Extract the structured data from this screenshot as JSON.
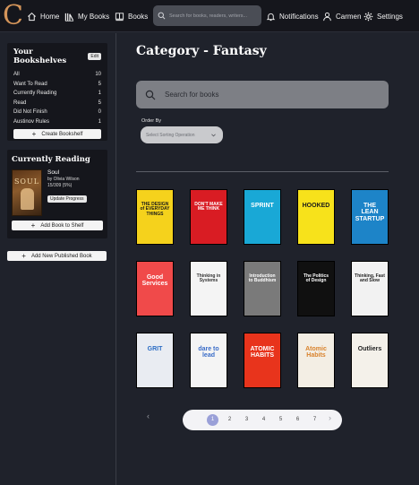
{
  "brand": {
    "logo_letter": "C"
  },
  "nav": {
    "home": "Home",
    "my_books": "My Books",
    "books": "Books",
    "search_placeholder": "Search for books, readers, writers...",
    "notifications": "Notifications",
    "user": "Carmen",
    "settings": "Settings"
  },
  "sidebar": {
    "shelves_title": "Your Bookshelves",
    "edit_label": "Edit",
    "shelves": [
      {
        "name": "All",
        "count": "10"
      },
      {
        "name": "Want To Read",
        "count": "5"
      },
      {
        "name": "Currently Reading",
        "count": "1"
      },
      {
        "name": "Read",
        "count": "5"
      },
      {
        "name": "Did Not Finish",
        "count": "0"
      },
      {
        "name": "Austinov Rules",
        "count": "1"
      }
    ],
    "create_shelf": "Create Bookshelf",
    "reading_title": "Currently Reading",
    "current_book": {
      "cover_text": "SOUL",
      "title": "Soul",
      "author": "by Olivia Wilson",
      "progress": "15/309 (5%)",
      "update": "Update Progress"
    },
    "add_to_shelf": "Add Book to Shelf",
    "add_published": "Add New Published Book"
  },
  "main": {
    "title": "Category - Fantasy",
    "search_placeholder": "Search for books",
    "order_label": "Order By",
    "sort_placeholder": "Select Sorting Operation",
    "books": [
      {
        "bg": "#f5d21c",
        "fg": "#1a1a1a",
        "text": "THE DESIGN of EVERYDAY THINGS"
      },
      {
        "bg": "#d91c23",
        "fg": "#ffffff",
        "text": "DON'T MAKE ME THINK"
      },
      {
        "bg": "#19a8d6",
        "fg": "#ffffff",
        "text": "SPRINT"
      },
      {
        "bg": "#f7e21b",
        "fg": "#1a1a1a",
        "text": "HOOKED"
      },
      {
        "bg": "#1d84c8",
        "fg": "#ffffff",
        "text": "THE LEAN STARTUP"
      },
      {
        "bg": "#f04a4a",
        "fg": "#ffffff",
        "text": "Good Services"
      },
      {
        "bg": "#f4f4f4",
        "fg": "#333333",
        "text": "Thinking in Systems"
      },
      {
        "bg": "#7a7a7a",
        "fg": "#ffffff",
        "text": "Introduction to Buddhism"
      },
      {
        "bg": "#101010",
        "fg": "#ffffff",
        "text": "The Politics of Design"
      },
      {
        "bg": "#f2f2f2",
        "fg": "#222222",
        "text": "Thinking, Fast and Slow"
      },
      {
        "bg": "#e9ecf2",
        "fg": "#2b6cc4",
        "text": "GRIT"
      },
      {
        "bg": "#f4f4f4",
        "fg": "#3a6cc8",
        "text": "dare to lead"
      },
      {
        "bg": "#e8341c",
        "fg": "#ffffff",
        "text": "ATOMIC HABITS"
      },
      {
        "bg": "#f3eee4",
        "fg": "#d9822b",
        "text": "Atomic Habits"
      },
      {
        "bg": "#f4f1ea",
        "fg": "#222222",
        "text": "Outliers"
      }
    ],
    "pagination": {
      "prev": "‹",
      "next": "›",
      "pages": [
        "1",
        "2",
        "3",
        "4",
        "5",
        "6",
        "7"
      ],
      "current": "1"
    }
  }
}
